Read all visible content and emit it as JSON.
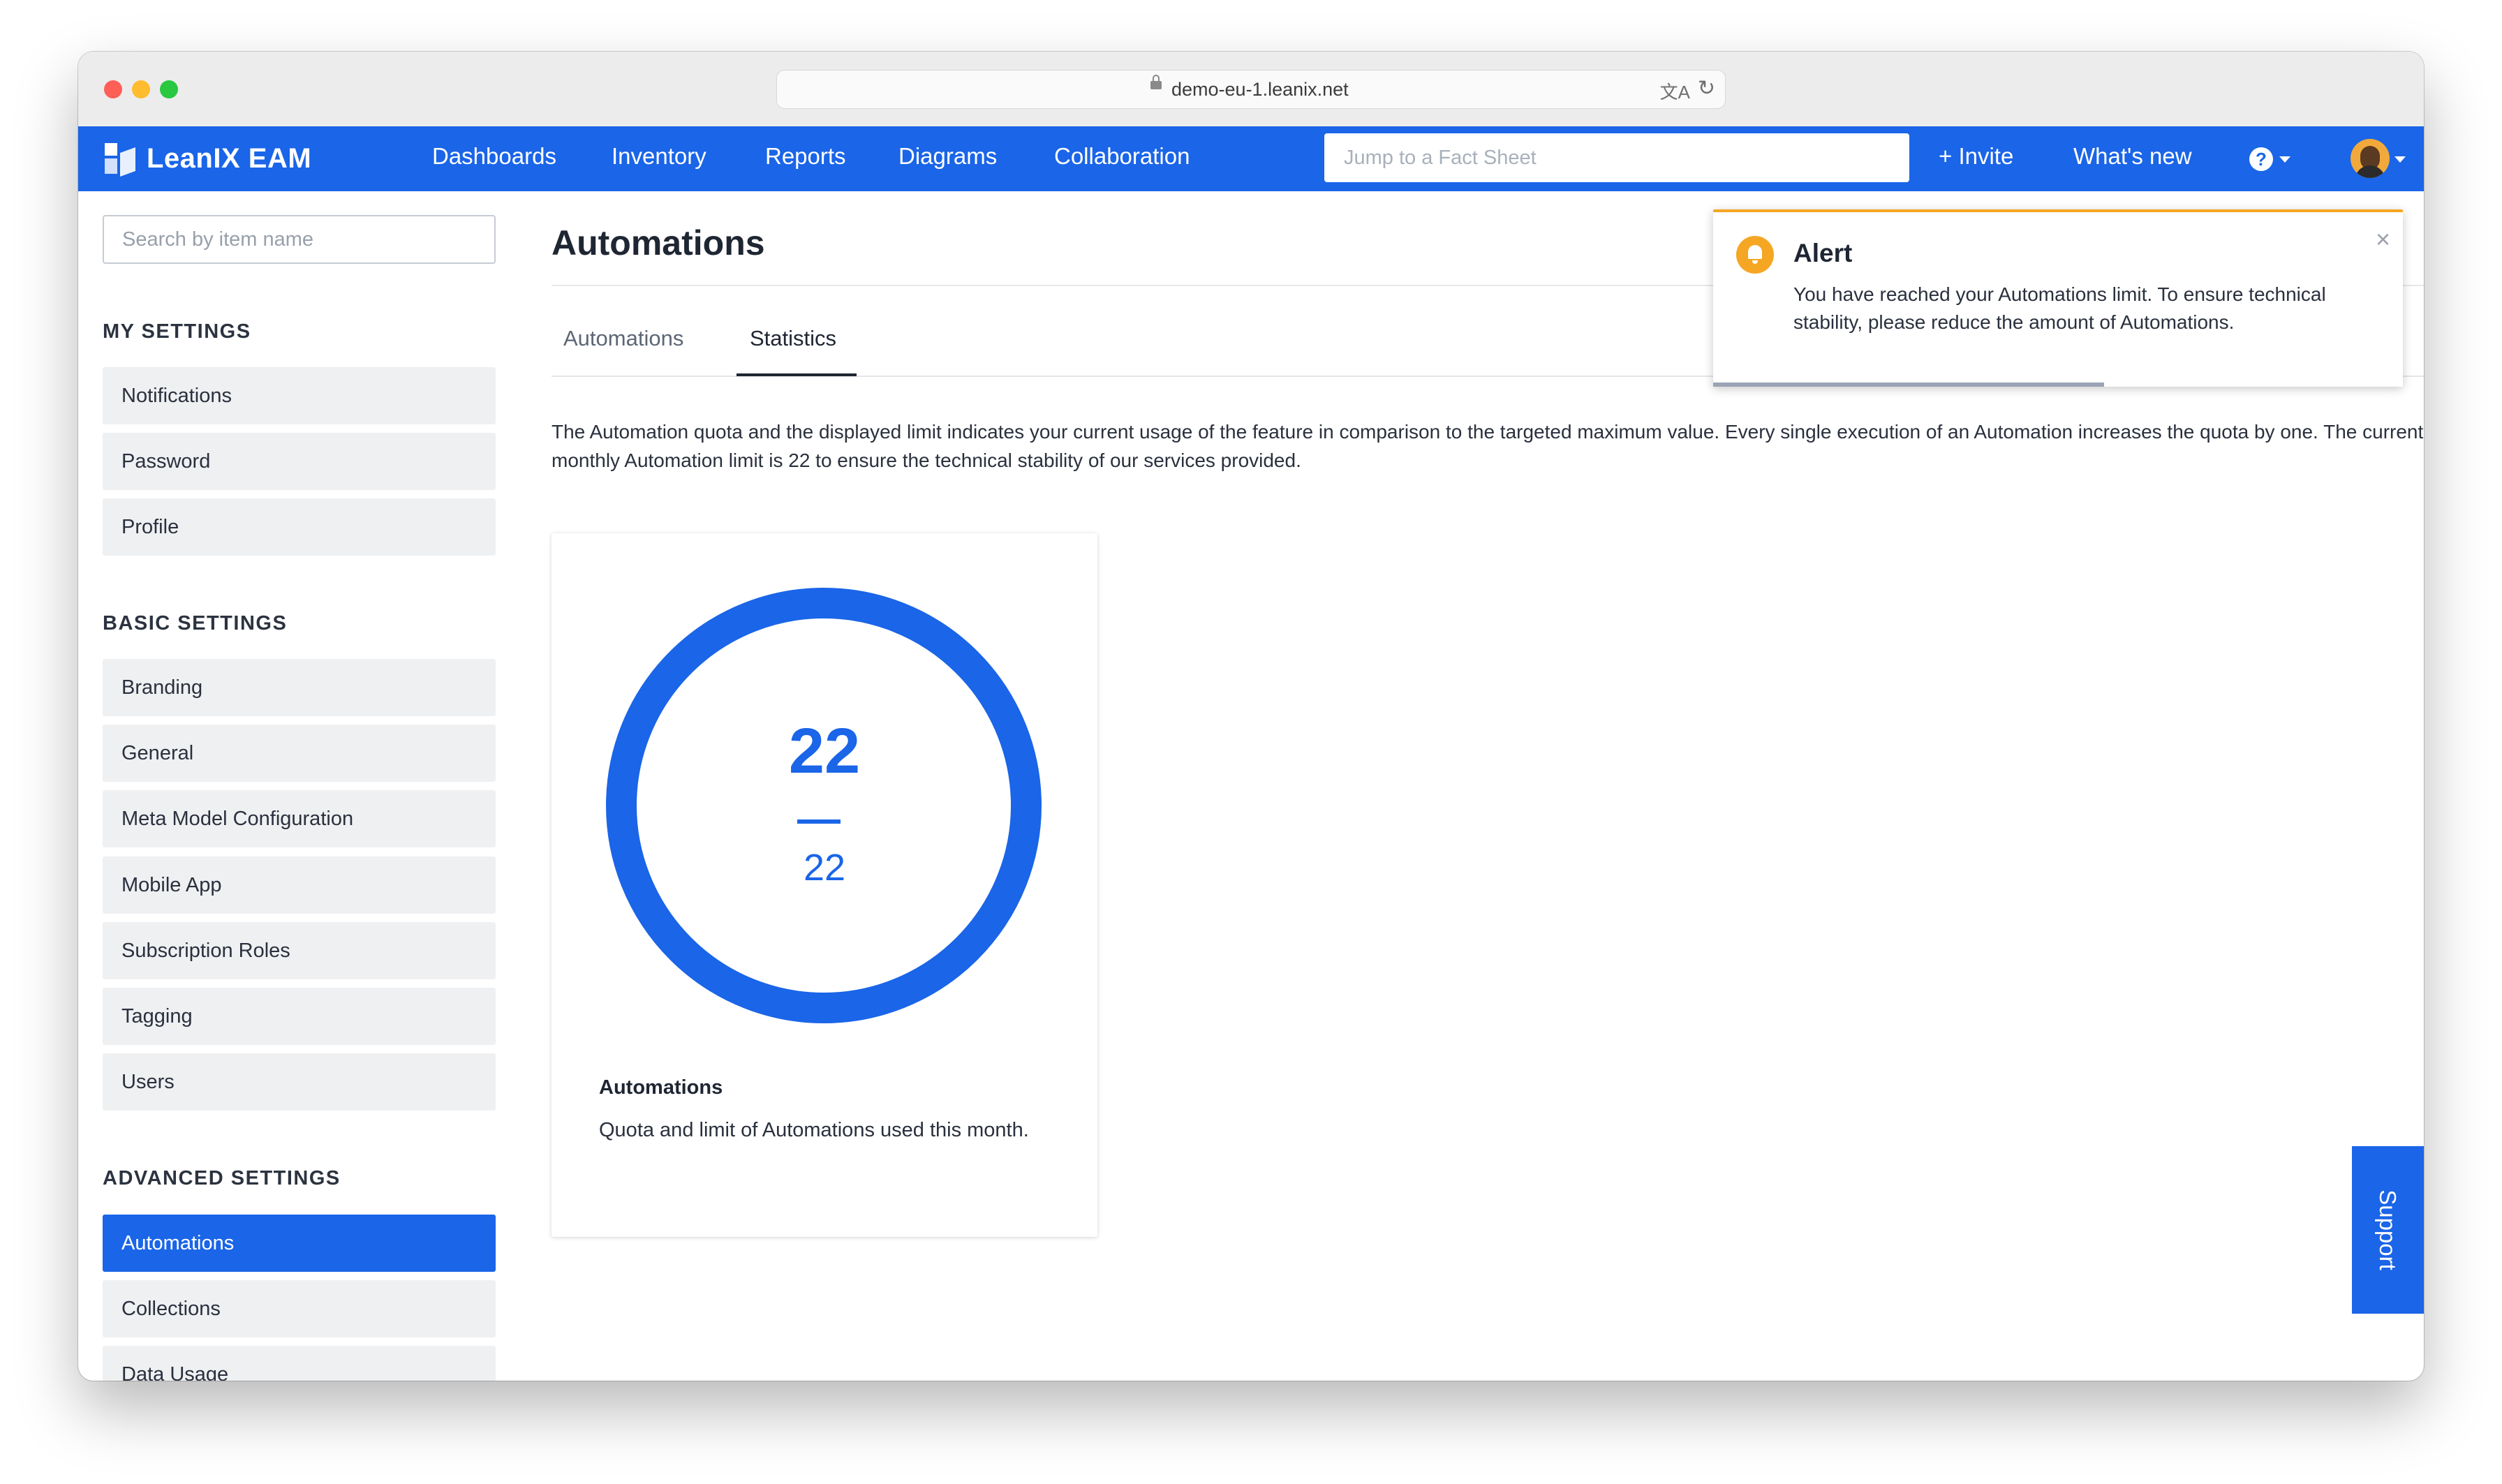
{
  "browser": {
    "url": "demo-eu-1.leanix.net"
  },
  "nav": {
    "brand": "LeanIX EAM",
    "items": [
      "Dashboards",
      "Inventory",
      "Reports",
      "Diagrams",
      "Collaboration"
    ],
    "jump_placeholder": "Jump to a Fact Sheet",
    "invite": "+ Invite",
    "whats_new": "What's new",
    "help": "?"
  },
  "sidebar": {
    "search_placeholder": "Search by item name",
    "my_settings_title": "MY SETTINGS",
    "my_settings": [
      "Notifications",
      "Password",
      "Profile"
    ],
    "basic_settings_title": "BASIC SETTINGS",
    "basic_settings": [
      "Branding",
      "General",
      "Meta Model Configuration",
      "Mobile App",
      "Subscription Roles",
      "Tagging",
      "Users"
    ],
    "advanced_settings_title": "ADVANCED SETTINGS",
    "advanced_settings": [
      "Automations",
      "Collections",
      "Data Usage"
    ],
    "active_item": "Automations"
  },
  "main": {
    "title": "Automations",
    "tabs": [
      {
        "label": "Automations",
        "active": false
      },
      {
        "label": "Statistics",
        "active": true
      }
    ],
    "description": "The Automation quota and the displayed limit indicates your current usage of the feature in comparison to the targeted maximum value. Every single execution of an Automation increases the quota by one. The current monthly Automation limit is 22 to ensure the technical stability of our services provided.",
    "card": {
      "used": "22",
      "limit": "22",
      "title": "Automations",
      "description": "Quota and limit of Automations used this month."
    }
  },
  "alert": {
    "title": "Alert",
    "message": "You have reached your Automations limit. To ensure technical stability, please reduce the amount of Automations.",
    "close": "×"
  },
  "support": {
    "label": "Support"
  },
  "colors": {
    "primary": "#1a65e8",
    "alert": "#f5a623"
  }
}
